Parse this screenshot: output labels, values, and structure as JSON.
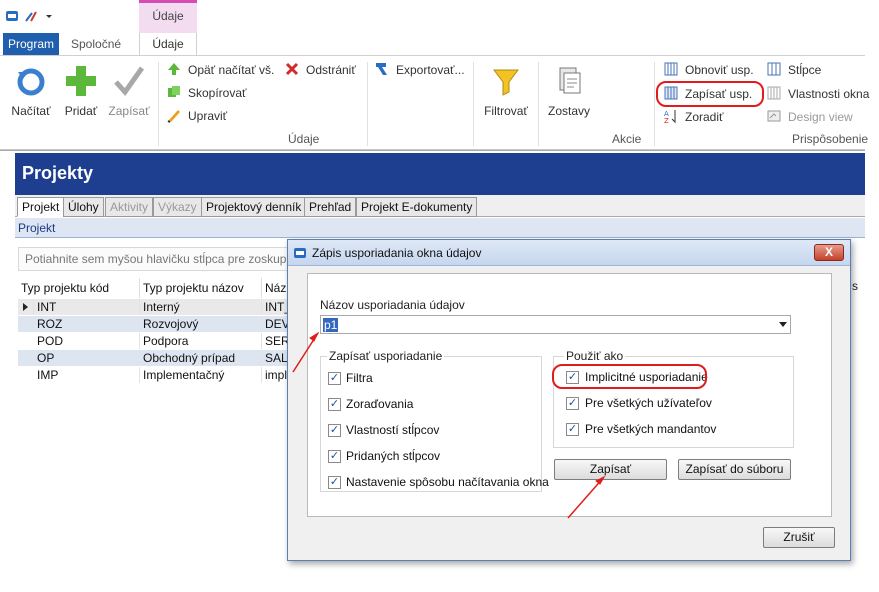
{
  "colors": {
    "accent": "#1f5fad",
    "header": "#1e3f8f",
    "context_tab": "#d34db4",
    "highlight": "#e01c1c"
  },
  "ribbon": {
    "context_header": "Údaje",
    "tabs": [
      "Program",
      "Spoločné",
      "Údaje"
    ],
    "buttons": {
      "nacitat": "Načítať",
      "pridat": "Pridať",
      "zapisat": "Zapísať",
      "opat_nacitat": "Opäť načítať vš.",
      "skopirovat": "Skopírovať",
      "upravit": "Upraviť",
      "odstranit": "Odstrániť",
      "exportovat": "Exportovať...",
      "filtrovat": "Filtrovať",
      "zostavy": "Zostavy",
      "obnovit_usp": "Obnoviť usp.",
      "zapisat_usp": "Zapísať usp.",
      "zoradit": "Zoradiť",
      "stlpce": "Stĺpce",
      "vlastnosti_okna": "Vlastnosti okna",
      "design_view": "Design view"
    },
    "groups": {
      "udaje": "Údaje",
      "akcie": "Akcie",
      "prisposobenie": "Prispôsobenie"
    }
  },
  "projekty": {
    "title": "Projekty",
    "tabs": [
      "Projekt",
      "Úlohy",
      "Aktivity",
      "Výkazy",
      "Projektový denník",
      "Prehľad",
      "Projekt E-dokumenty"
    ],
    "crumb": "Projekt",
    "group_hint": "Potiahnite sem myšou hlavičku stĺpca pre zoskup",
    "grid": {
      "headers": [
        "Typ projektu kód",
        "Typ projektu názov",
        "Náz"
      ],
      "rows": [
        [
          "INT",
          "Interný",
          "INT_"
        ],
        [
          "ROZ",
          "Rozvojový",
          "DEV_"
        ],
        [
          "POD",
          "Podpora",
          "SER"
        ],
        [
          "OP",
          "Obchodný prípad",
          "SAL"
        ],
        [
          "IMP",
          "Implementačný",
          "impl"
        ]
      ],
      "right_edge_text": "s"
    }
  },
  "dialog": {
    "title": "Zápis usporiadania okna údajov",
    "close_label": "X",
    "name_label": "Názov usporiadania údajov",
    "name_value": "p1",
    "left_group": {
      "legend": "Zapísať usporiadanie",
      "items": [
        "Filtra",
        "Zoraďovania",
        "Vlastností stĺpcov",
        "Pridaných stĺpcov",
        "Nastavenie spôsobu načítavania okna"
      ]
    },
    "right_group": {
      "legend": "Použiť ako",
      "items": [
        "Implicitné usporiadanie",
        "Pre všetkých užívateľov",
        "Pre všetkých mandantov"
      ]
    },
    "buttons": {
      "zapisat": "Zapísať",
      "zapisat_do_suboru": "Zapísať do súboru",
      "zrusit": "Zrušiť"
    }
  }
}
